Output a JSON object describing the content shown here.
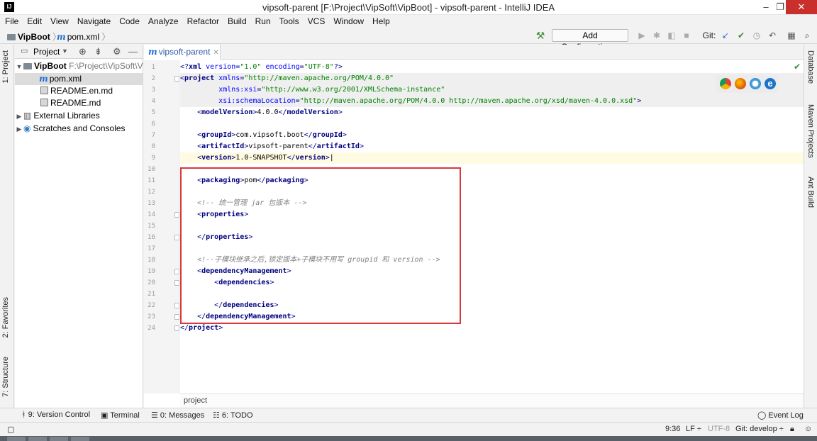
{
  "window": {
    "title": "vipsoft-parent [F:\\Project\\VipSoft\\VipBoot] - vipsoft-parent - IntelliJ IDEA",
    "app_icon_text": "IJ",
    "minimize": "‒",
    "restore": "❐",
    "close": "✕"
  },
  "menu": [
    "File",
    "Edit",
    "View",
    "Navigate",
    "Code",
    "Analyze",
    "Refactor",
    "Build",
    "Run",
    "Tools",
    "VCS",
    "Window",
    "Help"
  ],
  "navbar": {
    "breadcrumb_root": "VipBoot",
    "breadcrumb_file": "pom.xml",
    "add_configuration": "Add Configuration...",
    "git_label": "Git:"
  },
  "left_stripe": {
    "project_tab": "1: Project",
    "favorites_tab": "2: Favorites",
    "structure_tab": "7: Structure"
  },
  "project_panel": {
    "header_label": "Project",
    "tree": [
      {
        "label": "VipBoot",
        "path": "F:\\Project\\VipSoft\\Vi",
        "kind": "module",
        "expanded": true
      },
      {
        "label": "pom.xml",
        "kind": "maven-file",
        "selected": true
      },
      {
        "label": "README.en.md",
        "kind": "md-file"
      },
      {
        "label": "README.md",
        "kind": "md-file"
      },
      {
        "label": "External Libraries",
        "kind": "libraries"
      },
      {
        "label": "Scratches and Consoles",
        "kind": "scratches"
      }
    ]
  },
  "editor": {
    "tab_label": "vipsoft-parent",
    "breadcrumb": "project",
    "line_numbers": [
      "1",
      "2",
      "3",
      "4",
      "5",
      "6",
      "7",
      "8",
      "9",
      "10",
      "11",
      "12",
      "13",
      "14",
      "15",
      "16",
      "17",
      "18",
      "19",
      "20",
      "21",
      "22",
      "23",
      "24"
    ],
    "lines": [
      {
        "n": 1,
        "segments": [
          [
            "t",
            "<?"
          ],
          [
            "tn",
            "xml "
          ],
          [
            "an",
            "version"
          ],
          [
            "t",
            "="
          ],
          [
            "av",
            "\"1.0\""
          ],
          [
            "tx",
            " "
          ],
          [
            "an",
            "encoding"
          ],
          [
            "t",
            "="
          ],
          [
            "av",
            "\"UTF-8\""
          ],
          [
            "t",
            "?>"
          ]
        ]
      },
      {
        "n": 2,
        "segments": [
          [
            "t",
            "<"
          ],
          [
            "tn",
            "project "
          ],
          [
            "an",
            "xmlns"
          ],
          [
            "t",
            "="
          ],
          [
            "av",
            "\"http://maven.apache.org/POM/4.0.0\""
          ]
        ]
      },
      {
        "n": 3,
        "segments": [
          [
            "tx",
            "         "
          ],
          [
            "an",
            "xmlns:xsi"
          ],
          [
            "t",
            "="
          ],
          [
            "av",
            "\"http://www.w3.org/2001/XMLSchema-instance\""
          ]
        ]
      },
      {
        "n": 4,
        "segments": [
          [
            "tx",
            "         "
          ],
          [
            "an",
            "xsi:schemaLocation"
          ],
          [
            "t",
            "="
          ],
          [
            "av",
            "\"http://maven.apache.org/POM/4.0.0 http://maven.apache.org/xsd/maven-4.0.0.xsd\""
          ],
          [
            "t",
            ">"
          ]
        ]
      },
      {
        "n": 5,
        "segments": [
          [
            "tx",
            "    "
          ],
          [
            "t",
            "<"
          ],
          [
            "tn",
            "modelVersion"
          ],
          [
            "t",
            ">"
          ],
          [
            "tx",
            "4.0.0"
          ],
          [
            "t",
            "</"
          ],
          [
            "tn",
            "modelVersion"
          ],
          [
            "t",
            ">"
          ]
        ]
      },
      {
        "n": 6,
        "segments": []
      },
      {
        "n": 7,
        "segments": [
          [
            "tx",
            "    "
          ],
          [
            "t",
            "<"
          ],
          [
            "tn",
            "groupId"
          ],
          [
            "t",
            ">"
          ],
          [
            "tx",
            "com.vipsoft.boot"
          ],
          [
            "t",
            "</"
          ],
          [
            "tn",
            "groupId"
          ],
          [
            "t",
            ">"
          ]
        ]
      },
      {
        "n": 8,
        "segments": [
          [
            "tx",
            "    "
          ],
          [
            "t",
            "<"
          ],
          [
            "tn",
            "artifactId"
          ],
          [
            "t",
            ">"
          ],
          [
            "tx",
            "vipsoft-parent"
          ],
          [
            "t",
            "</"
          ],
          [
            "tn",
            "artifactId"
          ],
          [
            "t",
            ">"
          ]
        ]
      },
      {
        "n": 9,
        "segments": [
          [
            "tx",
            "    "
          ],
          [
            "t",
            "<"
          ],
          [
            "tn",
            "version"
          ],
          [
            "t",
            ">"
          ],
          [
            "tx",
            "1.0-SNAPSHOT"
          ],
          [
            "t",
            "</"
          ],
          [
            "tn",
            "version"
          ],
          [
            "t",
            ">"
          ]
        ]
      },
      {
        "n": 10,
        "segments": []
      },
      {
        "n": 11,
        "segments": [
          [
            "tx",
            "    "
          ],
          [
            "t",
            "<"
          ],
          [
            "tn",
            "packaging"
          ],
          [
            "t",
            ">"
          ],
          [
            "tx",
            "pom"
          ],
          [
            "t",
            "</"
          ],
          [
            "tn",
            "packaging"
          ],
          [
            "t",
            ">"
          ]
        ]
      },
      {
        "n": 12,
        "segments": []
      },
      {
        "n": 13,
        "segments": [
          [
            "tx",
            "    "
          ],
          [
            "cm",
            "<!-- 统一管理 jar 包版本 -->"
          ]
        ]
      },
      {
        "n": 14,
        "segments": [
          [
            "tx",
            "    "
          ],
          [
            "t",
            "<"
          ],
          [
            "tn",
            "properties"
          ],
          [
            "t",
            ">"
          ]
        ]
      },
      {
        "n": 15,
        "segments": []
      },
      {
        "n": 16,
        "segments": [
          [
            "tx",
            "    "
          ],
          [
            "t",
            "</"
          ],
          [
            "tn",
            "properties"
          ],
          [
            "t",
            ">"
          ]
        ]
      },
      {
        "n": 17,
        "segments": []
      },
      {
        "n": 18,
        "segments": [
          [
            "tx",
            "    "
          ],
          [
            "cm",
            "<!--子模块继承之后,锁定版本+子模块不用写 groupid 和 version -->"
          ]
        ]
      },
      {
        "n": 19,
        "segments": [
          [
            "tx",
            "    "
          ],
          [
            "t",
            "<"
          ],
          [
            "tn",
            "dependencyManagement"
          ],
          [
            "t",
            ">"
          ]
        ]
      },
      {
        "n": 20,
        "segments": [
          [
            "tx",
            "        "
          ],
          [
            "t",
            "<"
          ],
          [
            "tn",
            "dependencies"
          ],
          [
            "t",
            ">"
          ]
        ]
      },
      {
        "n": 21,
        "segments": []
      },
      {
        "n": 22,
        "segments": [
          [
            "tx",
            "        "
          ],
          [
            "t",
            "</"
          ],
          [
            "tn",
            "dependencies"
          ],
          [
            "t",
            ">"
          ]
        ]
      },
      {
        "n": 23,
        "segments": [
          [
            "tx",
            "    "
          ],
          [
            "t",
            "</"
          ],
          [
            "tn",
            "dependencyManagement"
          ],
          [
            "t",
            ">"
          ]
        ]
      },
      {
        "n": 24,
        "segments": [
          [
            "t",
            "</"
          ],
          [
            "tn",
            "project"
          ],
          [
            "t",
            ">"
          ]
        ]
      }
    ]
  },
  "right_stripe": {
    "database_tab": "Database",
    "maven_tab": "Maven Projects",
    "ant_tab": "Ant Build"
  },
  "bottom_tools": {
    "version_control": "9: Version Control",
    "terminal": "Terminal",
    "messages": "0: Messages",
    "todo": "6: TODO",
    "event_log": "Event Log"
  },
  "status": {
    "position": "9:36",
    "line_sep": "LF ÷",
    "encoding": "UTF-8",
    "git_branch": "Git: develop ÷"
  },
  "colors": {
    "tag": "#000080",
    "attr_name": "#0000ff",
    "attr_value": "#008000",
    "comment": "#808080",
    "highlight_box": "#d9383b",
    "maven_icon": "#1d6fd1"
  }
}
